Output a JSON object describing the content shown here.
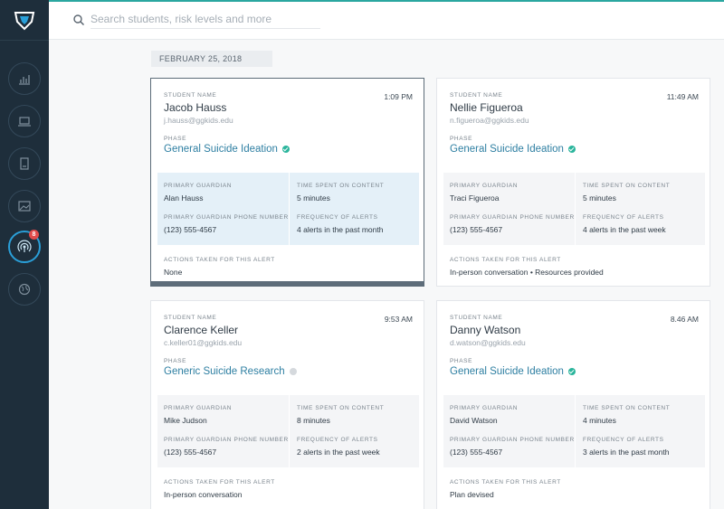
{
  "search": {
    "placeholder": "Search students, risk levels and more"
  },
  "date_label": "FEBRUARY 25, 2018",
  "nav": {
    "badge_count": "8"
  },
  "labels": {
    "student_name": "STUDENT NAME",
    "phase": "PHASE",
    "primary_guardian": "PRIMARY GUARDIAN",
    "time_spent": "TIME SPENT ON CONTENT",
    "guardian_phone": "PRIMARY GUARDIAN PHONE NUMBER",
    "frequency": "FREQUENCY OF ALERTS",
    "actions": "ACTIONS TAKEN FOR THIS ALERT"
  },
  "colors": {
    "accent": "#2a9fd8",
    "ok": "#2bb59c",
    "sidebar": "#1e2e3b"
  },
  "cards": [
    {
      "name": "Jacob Hauss",
      "email": "j.hauss@ggkids.edu",
      "time": "1:09 PM",
      "phase": "General Suicide Ideation",
      "status": "verified",
      "guardian": "Alan Hauss",
      "time_spent": "5 minutes",
      "phone": "(123) 555-4567",
      "frequency": "4 alerts in the past month",
      "actions": "None"
    },
    {
      "name": "Nellie Figueroa",
      "email": "n.figueroa@ggkids.edu",
      "time": "11:49 AM",
      "phase": "General Suicide Ideation",
      "status": "verified",
      "guardian": "Traci Figueroa",
      "time_spent": "5 minutes",
      "phone": "(123) 555-4567",
      "frequency": "4 alerts in the past week",
      "actions": "In-person conversation  •  Resources provided"
    },
    {
      "name": "Clarence Keller",
      "email": "c.keller01@ggkids.edu",
      "time": "9:53 AM",
      "phase": "Generic Suicide Research",
      "status": "pending",
      "guardian": "Mike Judson",
      "time_spent": "8 minutes",
      "phone": "(123) 555-4567",
      "frequency": "2 alerts in the past week",
      "actions": "In-person conversation"
    },
    {
      "name": "Danny Watson",
      "email": "d.watson@ggkids.edu",
      "time": "8.46 AM",
      "phase": "General Suicide Ideation",
      "status": "verified",
      "guardian": "David Watson",
      "time_spent": "4 minutes",
      "phone": "(123) 555-4567",
      "frequency": "3 alerts in the past month",
      "actions": "Plan devised"
    }
  ]
}
